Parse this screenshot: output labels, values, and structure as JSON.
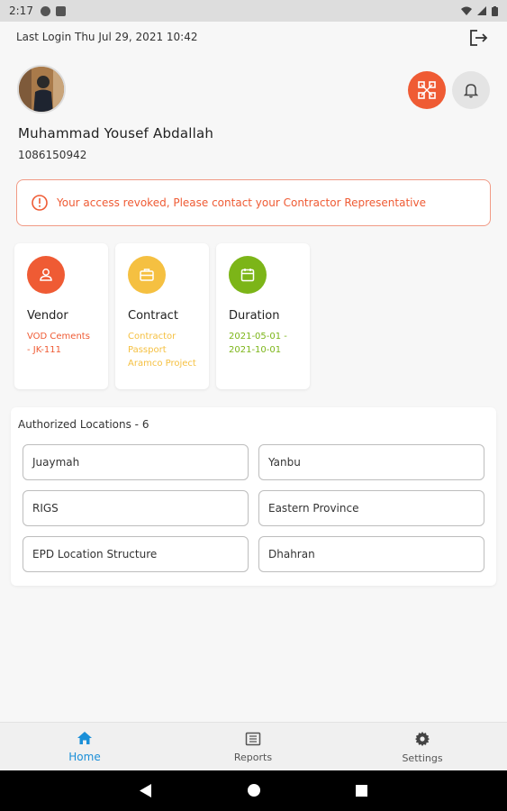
{
  "status_bar": {
    "time": "2:17"
  },
  "header": {
    "last_login": "Last Login Thu Jul 29, 2021 10:42"
  },
  "user": {
    "name": "Muhammad Yousef Abdallah",
    "id": "1086150942"
  },
  "alert": {
    "message": "Your access revoked, Please contact your Contractor Representative"
  },
  "cards": [
    {
      "title": "Vendor",
      "value": "VOD Cements - JK-111",
      "color": "#ef5b34",
      "icon": "person-icon"
    },
    {
      "title": "Contract",
      "value": "Contractor Passport Aramco Project",
      "color": "#f5c041",
      "icon": "briefcase-icon"
    },
    {
      "title": "Duration",
      "value": "2021-05-01 - 2021-10-01",
      "color": "#7cb518",
      "icon": "calendar-icon"
    }
  ],
  "locations": {
    "title": "Authorized Locations - 6",
    "items": [
      "Juaymah",
      "Yanbu",
      "RIGS",
      "Eastern Province",
      "EPD Location Structure",
      "Dhahran"
    ]
  },
  "bottom_nav": {
    "items": [
      {
        "label": "Home",
        "icon": "home-icon",
        "active": true
      },
      {
        "label": "Reports",
        "icon": "reports-icon",
        "active": false
      },
      {
        "label": "Settings",
        "icon": "gear-icon",
        "active": false
      }
    ]
  },
  "colors": {
    "accent": "#ef5b34",
    "nav_active": "#1a8fd8",
    "vendor": "#ef5b34",
    "contract": "#f5c041",
    "duration": "#7cb518"
  }
}
